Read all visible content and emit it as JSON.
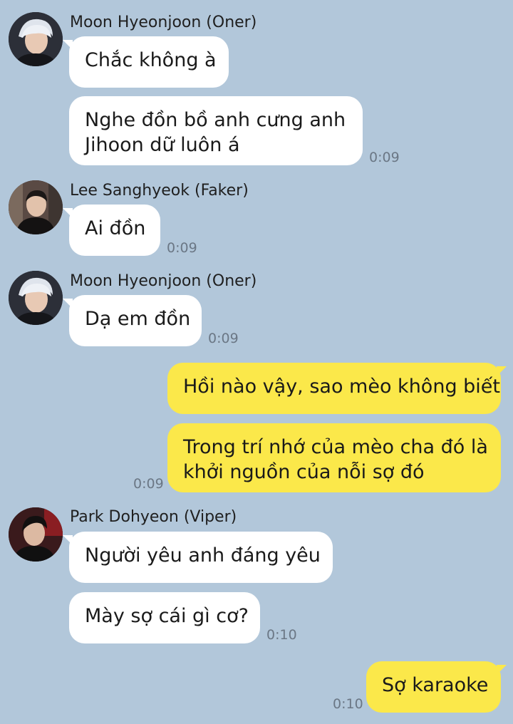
{
  "colors": {
    "background": "#b2c7da",
    "incoming_bubble": "#ffffff",
    "outgoing_bubble": "#fbe84a",
    "timestamp": "#6b7785"
  },
  "messages": {
    "g1": {
      "sender": "Moon Hyeonjoon (Oner)",
      "m1": "Chắc không à",
      "m2_line1": "Nghe đồn bồ anh cưng anh",
      "m2_line2": "Jihoon dữ luôn á",
      "time": "0:09"
    },
    "g2": {
      "sender": "Lee Sanghyeok (Faker)",
      "m1": "Ai đồn",
      "time": "0:09"
    },
    "g3": {
      "sender": "Moon Hyeonjoon (Oner)",
      "m1": "Dạ em đồn",
      "time": "0:09"
    },
    "g4": {
      "m1": "Hồi nào vậy, sao mèo không biết",
      "m2_line1": "Trong trí nhớ của mèo cha đó là",
      "m2_line2": "khởi nguồn của nỗi sợ đó",
      "time": "0:09"
    },
    "g5": {
      "sender": "Park Dohyeon (Viper)",
      "m1": "Người yêu anh đáng yêu",
      "m2": "Mày sợ cái gì cơ?",
      "time": "0:10"
    },
    "g6": {
      "m1": "Sợ karaoke",
      "time": "0:10"
    }
  }
}
